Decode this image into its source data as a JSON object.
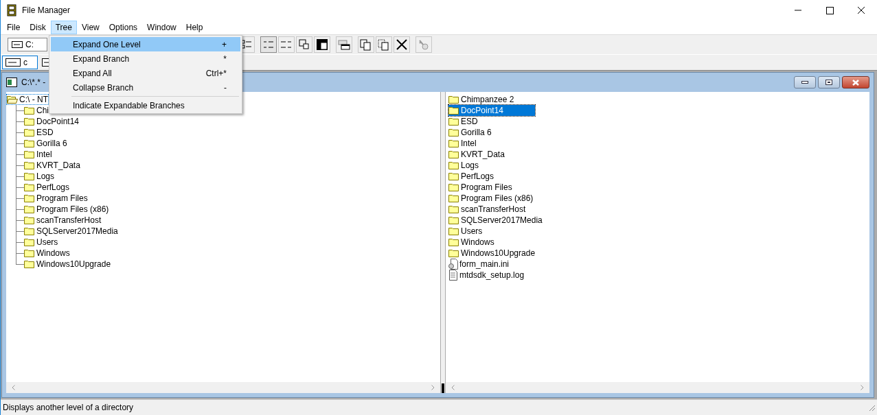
{
  "window": {
    "title": "File Manager"
  },
  "menu_bar": [
    {
      "label": "File",
      "selected": false
    },
    {
      "label": "Disk",
      "selected": false
    },
    {
      "label": "Tree",
      "selected": true
    },
    {
      "label": "View",
      "selected": false
    },
    {
      "label": "Options",
      "selected": false
    },
    {
      "label": "Window",
      "selected": false
    },
    {
      "label": "Help",
      "selected": false
    }
  ],
  "tree_menu": [
    {
      "kind": "item",
      "label": "Expand One Level",
      "shortcut": "+",
      "selected": true
    },
    {
      "kind": "item",
      "label": "Expand Branch",
      "shortcut": "*",
      "selected": false
    },
    {
      "kind": "item",
      "label": "Expand All",
      "shortcut": "Ctrl+*",
      "selected": false
    },
    {
      "kind": "item",
      "label": "Collapse Branch",
      "shortcut": "-",
      "selected": false
    },
    {
      "kind": "separator"
    },
    {
      "kind": "item",
      "label": "Indicate Expandable Branches",
      "selected": false
    }
  ],
  "toolbar": {
    "drive_combo": "C:"
  },
  "drive_bar": [
    {
      "label": "c",
      "selected": true
    }
  ],
  "child_window": {
    "title": "C:\\*.* -"
  },
  "tree": {
    "label": "C:\\ - NT",
    "selected": true,
    "children": [
      {
        "label": "Chi",
        "selected": false
      },
      {
        "label": "DocPoint14",
        "selected": false
      },
      {
        "label": "ESD",
        "selected": false
      },
      {
        "label": "Gorilla 6",
        "selected": false
      },
      {
        "label": "Intel",
        "selected": false
      },
      {
        "label": "KVRT_Data",
        "selected": false
      },
      {
        "label": "Logs",
        "selected": false
      },
      {
        "label": "PerfLogs",
        "selected": false
      },
      {
        "label": "Program Files",
        "selected": false
      },
      {
        "label": "Program Files (x86)",
        "selected": false
      },
      {
        "label": "scanTransferHost",
        "selected": false
      },
      {
        "label": "SQLServer2017Media",
        "selected": false
      },
      {
        "label": "Users",
        "selected": false
      },
      {
        "label": "Windows",
        "selected": false
      },
      {
        "label": "Windows10Upgrade",
        "selected": false
      }
    ]
  },
  "files": [
    {
      "kind": "folder",
      "name": "Chimpanzee 2",
      "selected": false
    },
    {
      "kind": "folder",
      "name": "DocPoint14",
      "selected": true
    },
    {
      "kind": "folder",
      "name": "ESD",
      "selected": false
    },
    {
      "kind": "folder",
      "name": "Gorilla 6",
      "selected": false
    },
    {
      "kind": "folder",
      "name": "Intel",
      "selected": false
    },
    {
      "kind": "folder",
      "name": "KVRT_Data",
      "selected": false
    },
    {
      "kind": "folder",
      "name": "Logs",
      "selected": false
    },
    {
      "kind": "folder",
      "name": "PerfLogs",
      "selected": false
    },
    {
      "kind": "folder",
      "name": "Program Files",
      "selected": false
    },
    {
      "kind": "folder",
      "name": "Program Files (x86)",
      "selected": false
    },
    {
      "kind": "folder",
      "name": "scanTransferHost",
      "selected": false
    },
    {
      "kind": "folder",
      "name": "SQLServer2017Media",
      "selected": false
    },
    {
      "kind": "folder",
      "name": "Users",
      "selected": false
    },
    {
      "kind": "folder",
      "name": "Windows",
      "selected": false
    },
    {
      "kind": "folder",
      "name": "Windows10Upgrade",
      "selected": false
    },
    {
      "kind": "settings",
      "name": "form_main.ini",
      "selected": false
    },
    {
      "kind": "text",
      "name": "mtdsdk_setup.log",
      "selected": false
    }
  ],
  "status_bar": "Displays another level of a directory"
}
